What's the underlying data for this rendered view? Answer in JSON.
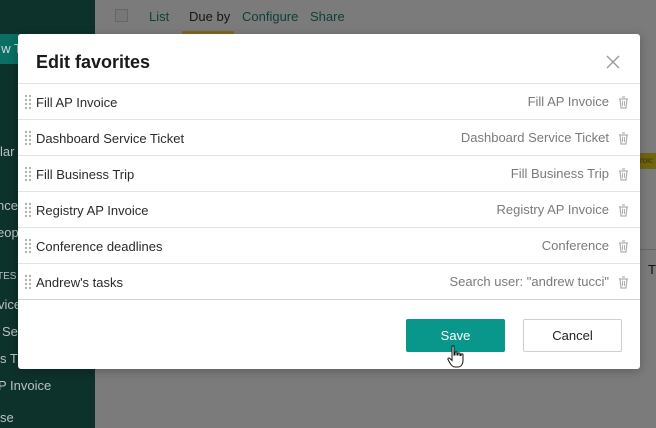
{
  "background": {
    "sidebar": {
      "brand_fragment": "w T",
      "items": [
        "lar",
        "nce",
        "eop",
        "TES",
        "vice",
        "Ser",
        "s T",
        "P Invoice",
        "se"
      ]
    },
    "topbar": {
      "tabs": [
        "List",
        "Due by",
        "Configure",
        "Share"
      ],
      "active_tab": "Due by"
    },
    "badge_fragment": "roic",
    "cell_fragment": "T"
  },
  "modal": {
    "title": "Edit favorites",
    "close_icon": "close-icon",
    "rows": [
      {
        "name": "Fill AP Invoice",
        "value": "Fill AP Invoice"
      },
      {
        "name": "Dashboard Service Ticket",
        "value": "Dashboard Service Ticket"
      },
      {
        "name": "Fill Business Trip",
        "value": "Fill Business Trip"
      },
      {
        "name": "Registry AP Invoice",
        "value": "Registry AP Invoice"
      },
      {
        "name": "Conference deadlines",
        "value": "Conference"
      },
      {
        "name": "Andrew's tasks",
        "value": "Search user: \"andrew tucci\""
      }
    ],
    "save_label": "Save",
    "cancel_label": "Cancel"
  },
  "colors": {
    "accent": "#0a978b",
    "sidebar": "#0d312b",
    "overlay": "#7b7b7b"
  }
}
